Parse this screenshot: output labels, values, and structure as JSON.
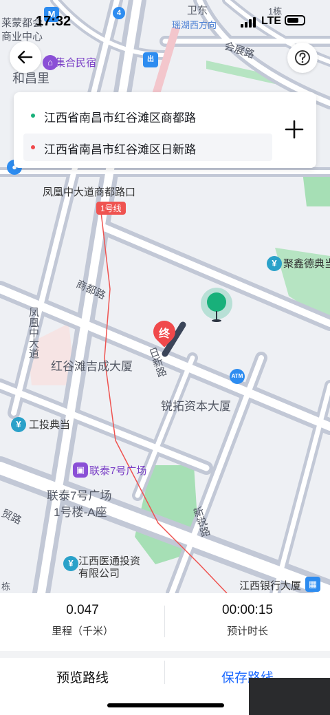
{
  "status_bar": {
    "time": "17:32",
    "network": "LTE"
  },
  "map": {
    "labels": {
      "top_left_1": "莱蒙都会",
      "top_left_2": "商业中心",
      "hechang": "和昌里",
      "jihe": "集合民宿",
      "weidong": "卫东",
      "yaohu": "瑶湖西方向",
      "huizhan": "会展路",
      "dong1": "1栋",
      "fenghuang_shangdu": "凤凰中大道商都路口",
      "line1": "1号线",
      "shangdu_road": "商都路",
      "fenghuang_road": "凤凰中大道",
      "hongguang_jicheng": "红谷滩吉成大厦",
      "rixin_road": "日新路",
      "ruituo": "锐拓资本大厦",
      "jujinde": "聚鑫德典当",
      "gongtou": "工投典当",
      "liantai_plaza": "联泰7号广场",
      "liantai_a": "联泰7号广场",
      "liantai_a2": "1号楼-A座",
      "xinrui_road": "新锐路",
      "mao_road": "贸路",
      "yitong_1": "江西医通投资",
      "yitong_2": "有限公司",
      "bank": "江西银行大厦",
      "dong2": "栋",
      "end_marker": "终",
      "metro_badge": "4",
      "atm": "ATM"
    }
  },
  "route_card": {
    "start": "江西省南昌市红谷滩区商都路",
    "end": "江西省南昌市红谷滩区日新路",
    "start_color": "#18b07a",
    "end_color": "#f0494b"
  },
  "stats": {
    "distance_value": "0.047",
    "distance_label": "里程（千米）",
    "duration_value": "00:00:15",
    "duration_label": "预计时长"
  },
  "actions": {
    "preview": "预览路线",
    "save": "保存路线",
    "save_color": "#1f6bff"
  }
}
